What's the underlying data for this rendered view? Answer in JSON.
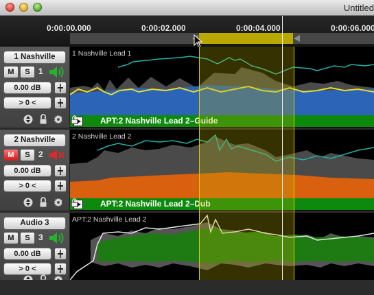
{
  "window": {
    "title": "Untitled"
  },
  "timeline": {
    "labels": [
      "0:00:00.000",
      "0:00:02.000",
      "0:00:04.000",
      "0:00:06.000"
    ]
  },
  "tracks": [
    {
      "name": "1 Nashville",
      "mute_label": "M",
      "solo_label": "S",
      "number": "1",
      "muted": false,
      "volume": "0.00 dB",
      "pan": "> 0 <",
      "lane_label": "1 Nashville Lead 1",
      "guide_label": "APT:2 Nashville Lead 2–Guide",
      "fill_color": "#2c64b8",
      "line_color": "#e8dd2a",
      "pitch_color": "#1fb3a8"
    },
    {
      "name": "2 Nashville",
      "mute_label": "M",
      "solo_label": "S",
      "number": "2",
      "muted": true,
      "volume": "0.00 dB",
      "pan": "> 0 <",
      "lane_label": "2 Nashville Lead 2",
      "guide_label": "APT:2 Nashville Lead 2–Dub",
      "fill_color": "#d9600e",
      "line_color": "#e07a20",
      "pitch_color": "#1fb3a8"
    },
    {
      "name": "Audio 3",
      "mute_label": "M",
      "solo_label": "S",
      "number": "3",
      "muted": false,
      "volume": "0.00 dB",
      "pan": "> 0 <",
      "lane_label": "APT:2 Nashville Lead 2",
      "fill_color": "#1e7a12",
      "line_color": "#dcdcdc",
      "pitch_color": "#e6e6e6"
    }
  ],
  "colors": {
    "loop_region": "#b8a800",
    "guide_bar": "#0d8a0d",
    "mute_active": "#d41818"
  },
  "icons": [
    "close-window-icon",
    "minimize-window-icon",
    "zoom-window-icon",
    "speaker-on-icon",
    "speaker-muted-icon",
    "volume-knob-icon",
    "pan-knob-icon",
    "updown-arrows-icon",
    "lock-icon",
    "gear-icon",
    "play-icon"
  ]
}
